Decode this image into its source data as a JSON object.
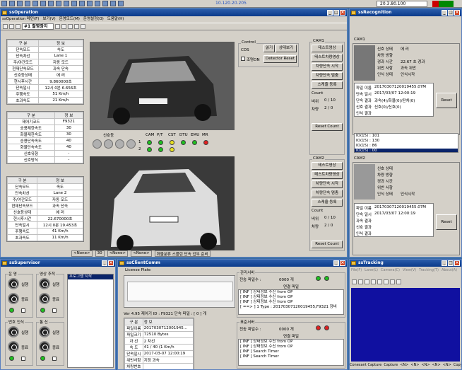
{
  "taskbar": {
    "ip_label": "10.120.20.205",
    "version": "20.3.80.100"
  },
  "operation": {
    "title": "ssOperation",
    "menu": [
      "ssOperation 메인(F)",
      "보기(V)",
      "운영모드(M)",
      "운영설정(O)",
      "도움말(H)"
    ],
    "toolbar_title": "#1 촬영장치",
    "table1": {
      "headers": [
        "구 분",
        "정 보"
      ],
      "rows": [
        [
          "단속모드",
          "속도"
        ],
        [
          "단속차선",
          "Lane 1"
        ],
        [
          "주/야간모드",
          "자동 모드"
        ],
        [
          "현재단속모드",
          "과속 단속"
        ],
        [
          "신호등상태",
          "에 러"
        ],
        [
          "현시후시간",
          "9.860000초"
        ],
        [
          "단속일시",
          "12시 0분 6.656초"
        ],
        [
          "주행속도",
          "51 Km/h"
        ],
        [
          "초과속도",
          "21 Km/h"
        ]
      ]
    },
    "table2": {
      "headers": [
        "구 분",
        "정 보"
      ],
      "rows": [
        [
          "제어기코드",
          "F9321"
        ],
        [
          "승용제한속도",
          "30"
        ],
        [
          "화물제한속도",
          "30"
        ],
        [
          "승용단속속도",
          "40"
        ],
        [
          "화물단속속도",
          "40"
        ],
        [
          "신호유형",
          "-"
        ],
        [
          "신호방식",
          "-"
        ]
      ]
    },
    "table3": {
      "headers": [
        "구 분",
        "정 보"
      ],
      "rows": [
        [
          "단속모드",
          "속도"
        ],
        [
          "단속차선",
          "Lane 2"
        ],
        [
          "주/야간모드",
          "자동 모드"
        ],
        [
          "현재단속모드",
          "과속 단속"
        ],
        [
          "신호등상태",
          "에 러"
        ],
        [
          "현시후시간",
          "22.670000초"
        ],
        [
          "단속일시",
          "12시 0분 19.453초"
        ],
        [
          "주행속도",
          "41 Km/h"
        ],
        [
          "초과속도",
          "11 Km/h"
        ]
      ]
    },
    "signal_label": "신호등",
    "led_headers": [
      "CAM",
      "P/T",
      "CST",
      "DTU",
      "EMU",
      "MR"
    ],
    "led_rows": [
      "1",
      "2"
    ],
    "control": {
      "label": "Control",
      "cds": "CDS",
      "light": "조명ON",
      "read": "읽기",
      "status_view": "상태보기",
      "detector_reset": "Detector Reset"
    },
    "cam1": {
      "label": "CAM1",
      "buttons": [
        "테스트영상",
        "테스트차량영상",
        "차량단속 시작",
        "차량단속 멈춤",
        "스케줄 등록"
      ],
      "count_label": "Count",
      "count_rows": [
        [
          "비위",
          "0 / 10"
        ],
        [
          "차량",
          "2 / 0"
        ]
      ],
      "reset": "Reset Count"
    },
    "cam2": {
      "label": "CAM2",
      "buttons": [
        "테스트영상",
        "테스트차량영상",
        "차량단속 시작",
        "차량단속 멈춤",
        "스케줄 등록"
      ],
      "count_label": "Count",
      "count_rows": [
        [
          "비위",
          "0 / 10"
        ],
        [
          "차량",
          "2 / 0"
        ]
      ],
      "reset": "Reset Count"
    },
    "statusbar": [
      "<None>",
      "30",
      "<None>",
      "<None>",
      "화물분류 스플린 단속 업무 준비"
    ]
  },
  "recognition": {
    "title": "ssRecognition",
    "cam1": {
      "label": "CAM1",
      "info": [
        [
          "신호 상태",
          "에 러"
        ],
        [
          "차량 방향",
          ""
        ],
        [
          "경과 시간",
          "22.67 초 경과"
        ],
        [
          "위반 사항",
          "과속 위반"
        ],
        [
          "인식 상태",
          "인식시작"
        ]
      ],
      "result": [
        [
          "파일 이름",
          "20170307120019455.07M"
        ],
        [
          "단속 일시",
          "2017/03/07 12:00:19"
        ],
        [
          "단속 결과",
          "과속(4)/화물(0)/판차(0)"
        ],
        [
          "신호 결과",
          "신호(0)/신호(0)"
        ],
        [
          "인식 결과",
          ""
        ]
      ],
      "reset": "Reset"
    },
    "log": [
      "IO(15) : 101",
      "IO(15) : 130",
      "IO(15) : 86",
      "IO(15) : 00"
    ],
    "cam2": {
      "label": "CAM2",
      "info": [
        [
          "신호 상태",
          ""
        ],
        [
          "차량 방향",
          ""
        ],
        [
          "경과 시간",
          ""
        ],
        [
          "위반 사항",
          ""
        ],
        [
          "인식 상태",
          "인식시작"
        ]
      ],
      "result": [
        [
          "파일 이름",
          "20170307120019455.07M"
        ],
        [
          "단속 일시",
          "2017/03/07 12:00:19"
        ],
        [
          "과속 결과",
          ""
        ],
        [
          "신호 결과",
          ""
        ],
        [
          "인식 결과",
          ""
        ]
      ],
      "reset": "Reset"
    }
  },
  "supervisor": {
    "title": "ssSupervisor",
    "groups": [
      {
        "label": "운 영",
        "start": "실행",
        "stop": "종료"
      },
      {
        "label": "영상 추적",
        "start": "실행",
        "stop": "종료"
      },
      {
        "label": "번호 인식",
        "start": "실행",
        "stop": "종료"
      },
      {
        "label": "통 신",
        "start": "실행",
        "stop": "종료"
      }
    ],
    "list_item": "프로그램 시작"
  },
  "client": {
    "title": "ssClientComm",
    "license_label": "License Plate",
    "ver_line": "Ver 4.95  제어기 ID : F9321  단속 파일 : [ 0 ]  개",
    "table": [
      [
        "구 분",
        "정 보"
      ],
      [
        "파일이름",
        "2017030712001945..."
      ],
      [
        "파일크기",
        "72510 Bytes"
      ],
      [
        "차 선",
        "2 차선"
      ],
      [
        "속 도",
        "41 / 40 (1 Km/h"
      ],
      [
        "단속일시",
        "2017-03-07 12:00:19"
      ],
      [
        "위반사항",
        "지정 과속"
      ],
      [
        "차량번호",
        ""
      ]
    ],
    "server1": {
      "label": "관리서버",
      "send": "전송 파일수 :",
      "count": "0000 개",
      "conn": "연결 파일",
      "logs": [
        "[ INF ] 상태정보 수신 from OP",
        "[ INF ] 상태정보 수신 from OP",
        "[ INF ] 상태정보 수신 from OP",
        "[ ==> ] 1 Type : 20170307120019455,F9321 장비"
      ]
    },
    "server2": {
      "label": "표준서버",
      "send": "전송 파일수 :",
      "count": "0000 개",
      "conn": "연결 파일",
      "logs": [
        "[ INF ] 상태정보 수신 from OP",
        "[ INF ] 상태정보 수신 from OP",
        "[ INF ] Search Timer",
        "[ INF ] Search Timer"
      ]
    }
  },
  "tracking": {
    "title": "ssTracking",
    "menu": [
      "File(F)",
      "Lane(L)",
      "Camera(C)",
      "View(V)",
      "Tracking(T)",
      "About(A)"
    ],
    "statusbar": [
      "Conexant Capture",
      "Capture",
      "<N>",
      "<N>",
      "<N>",
      "<N>",
      "<N>",
      "Copy"
    ]
  },
  "colors": {
    "led_green": "#20c020",
    "led_yellow": "#e8e020",
    "led_red": "#e02020",
    "tracking_bg": "#1010a0"
  }
}
